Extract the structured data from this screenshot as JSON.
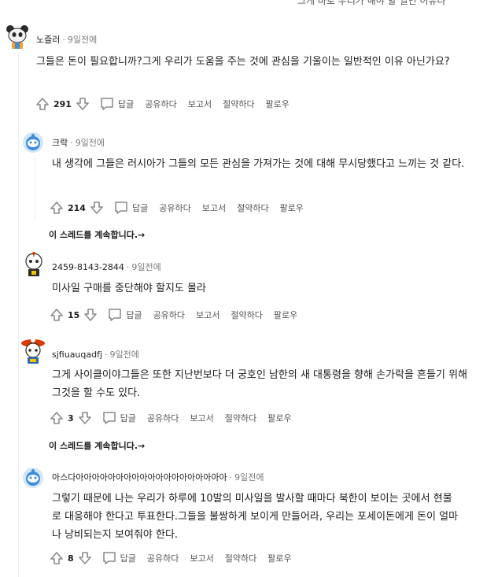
{
  "top_cut_text": "그게 바로 우리가 해야 할 일인 이유다",
  "comments": [
    {
      "author": "노즐러",
      "time": "9일전에",
      "body": "그들은 돈이 필요합니까?그게 우리가 도움을 주는 것에 관심을 기울이는 일반적인 이유 아닌가요?",
      "score": "291",
      "actions": {
        "reply": "답글",
        "share": "공유하다",
        "report": "보고서",
        "save": "절약하다",
        "follow": "팔로우"
      }
    },
    {
      "author": "크락",
      "time": "9일전에",
      "body": "내 생각에 그들은 러시아가 그들의 모든 관심을 가져가는 것에 대해 무시당했다고 느끼는 것 같다.",
      "score": "214",
      "actions": {
        "reply": "답글",
        "share": "공유하다",
        "report": "보고서",
        "save": "절약하다",
        "follow": "팔로우"
      },
      "continue_thread": "이 스레드를 계속합니다.→"
    },
    {
      "author": "2459-8143-2844",
      "time": "9일전에",
      "body": "미사일 구매를 중단해야 할지도 몰라",
      "score": "15",
      "actions": {
        "reply": "답글",
        "share": "공유하다",
        "report": "보고서",
        "save": "절약하다",
        "follow": "팔로우"
      }
    },
    {
      "author": "sjfiuauqadfj",
      "time": "9일전에",
      "body": "그게 사이클이야그들은 또한 지난번보다 더 궁호인 남한의 새 대통령을 향해 손가락을 흔들기 위해 그것을 할 수도 있다.",
      "score": "3",
      "actions": {
        "reply": "답글",
        "share": "공유하다",
        "report": "보고서",
        "save": "절약하다",
        "follow": "팔로우"
      },
      "continue_thread": "이 스레드를 계속합니다.→"
    },
    {
      "author": "아스다아아아아아아아아아아아아아아아아아아아",
      "time": "9일전에",
      "body": "그렇기 때문에 나는 우리가 하루에 10발의 미사일을 발사할 때마다 북한이 보이는 곳에서 현물로 대응해야 한다고 투표한다.그들을 불쌍하게 보이게 만들어라, 우리는 포세이돈에게 돈이 얼마나 낭비되는지 보여줘야 한다.",
      "score": "8",
      "actions": {
        "reply": "답글",
        "share": "공유하다",
        "report": "보고서",
        "save": "절약하다",
        "follow": "팔로우"
      }
    }
  ]
}
